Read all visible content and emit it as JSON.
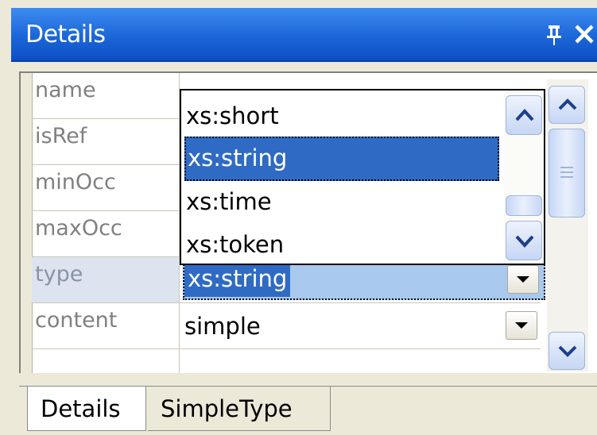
{
  "panel": {
    "title": "Details"
  },
  "grid": {
    "rows": [
      {
        "name": "name",
        "value": ""
      },
      {
        "name": "isRef",
        "value": ""
      },
      {
        "name": "minOcc",
        "value": ""
      },
      {
        "name": "maxOcc",
        "value": ""
      },
      {
        "name": "type",
        "value": "xs:string"
      },
      {
        "name": "content",
        "value": "simple"
      }
    ]
  },
  "dropdown": {
    "items": [
      "xs:short",
      "xs:string",
      "xs:time",
      "xs:token"
    ],
    "selected": "xs:string"
  },
  "tabs": [
    "Details",
    "SimpleType"
  ],
  "colors": {
    "title_bar": "#1c66d8",
    "selection": "#2f6bc4",
    "selected_row_bg": "#a9c8ee"
  },
  "icons": {
    "pin": "pin-icon",
    "close": "close-icon",
    "dropdown_arrow": "chevron-down-icon"
  }
}
